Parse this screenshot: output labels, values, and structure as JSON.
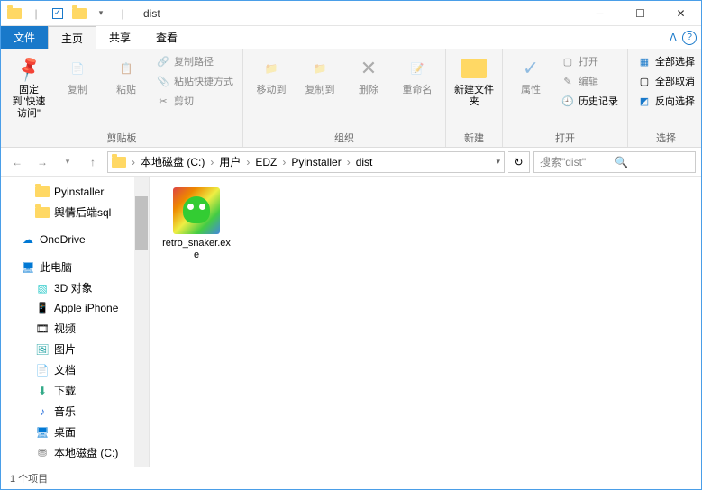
{
  "title": "dist",
  "tabs": {
    "file": "文件",
    "home": "主页",
    "share": "共享",
    "view": "查看"
  },
  "ribbon": {
    "pin": {
      "label": "固定到\"快速访问\""
    },
    "copy": "复制",
    "paste": "粘贴",
    "cut": "剪切",
    "copypath": "复制路径",
    "pasteshortcut": "粘贴快捷方式",
    "clipboard_group": "剪贴板",
    "moveto": "移动到",
    "copyto": "复制到",
    "delete": "删除",
    "rename": "重命名",
    "organize_group": "组织",
    "newfolder": "新建文件夹",
    "new_group": "新建",
    "properties": "属性",
    "open": "打开",
    "edit": "编辑",
    "history": "历史记录",
    "open_group": "打开",
    "selectall": "全部选择",
    "selectnone": "全部取消",
    "selectinvert": "反向选择",
    "select_group": "选择"
  },
  "breadcrumb": [
    "本地磁盘 (C:)",
    "用户",
    "EDZ",
    "Pyinstaller",
    "dist"
  ],
  "search_placeholder": "搜索\"dist\"",
  "sidebar": {
    "items": [
      {
        "label": "Pyinstaller",
        "icon": "folder",
        "indent": 2
      },
      {
        "label": "舆情后端sql",
        "icon": "folder",
        "indent": 2
      },
      {
        "label": "OneDrive",
        "icon": "onedrive",
        "indent": 1,
        "gap": true
      },
      {
        "label": "此电脑",
        "icon": "pc",
        "indent": 1,
        "gap": true
      },
      {
        "label": "3D 对象",
        "icon": "3d",
        "indent": 2
      },
      {
        "label": "Apple iPhone",
        "icon": "phone",
        "indent": 2
      },
      {
        "label": "视频",
        "icon": "video",
        "indent": 2
      },
      {
        "label": "图片",
        "icon": "pictures",
        "indent": 2
      },
      {
        "label": "文档",
        "icon": "docs",
        "indent": 2
      },
      {
        "label": "下载",
        "icon": "downloads",
        "indent": 2
      },
      {
        "label": "音乐",
        "icon": "music",
        "indent": 2
      },
      {
        "label": "桌面",
        "icon": "desktop",
        "indent": 2
      },
      {
        "label": "本地磁盘 (C:)",
        "icon": "disk",
        "indent": 2
      }
    ]
  },
  "files": [
    {
      "name": "retro_snaker.exe"
    }
  ],
  "status": "1 个项目"
}
